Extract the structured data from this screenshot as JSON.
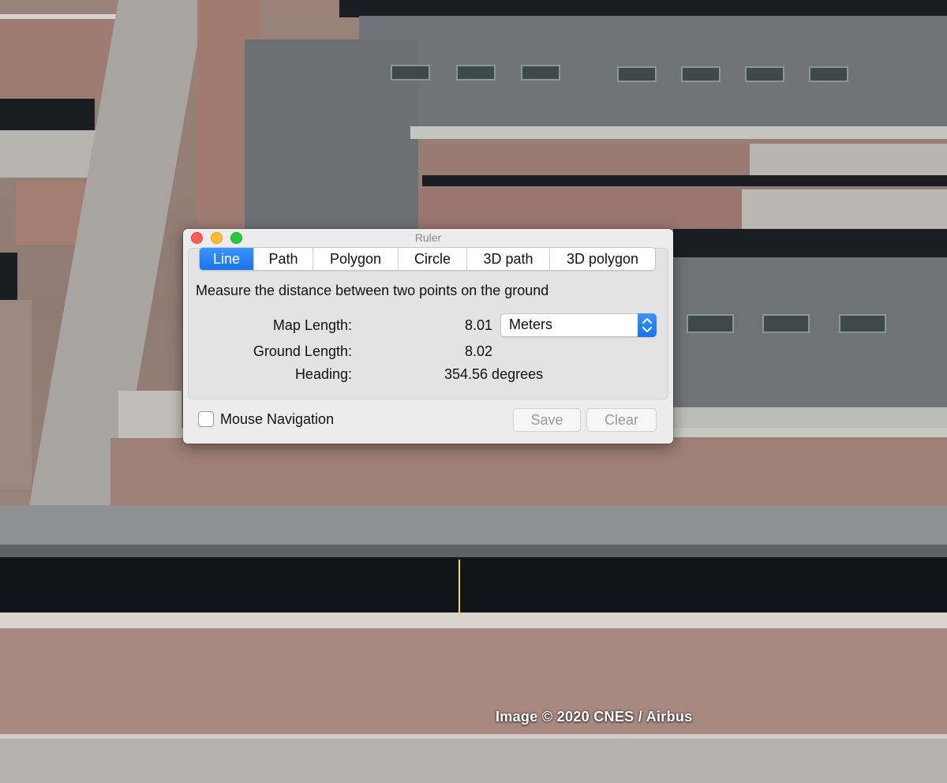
{
  "window": {
    "title": "Ruler"
  },
  "tabs": [
    {
      "label": "Line",
      "active": true
    },
    {
      "label": "Path",
      "active": false
    },
    {
      "label": "Polygon",
      "active": false
    },
    {
      "label": "Circle",
      "active": false
    },
    {
      "label": "3D path",
      "active": false
    },
    {
      "label": "3D polygon",
      "active": false
    }
  ],
  "description": "Measure the distance between two points on the ground",
  "measurements": {
    "map_length_label": "Map Length:",
    "map_length_value": "8.01",
    "unit_selected": "Meters",
    "ground_length_label": "Ground Length:",
    "ground_length_value": "8.02",
    "heading_label": "Heading:",
    "heading_value": "354.56 degrees"
  },
  "footer": {
    "mouse_navigation_label": "Mouse Navigation",
    "mouse_navigation_checked": false,
    "save_label": "Save",
    "clear_label": "Clear"
  },
  "map": {
    "copyright": "Image © 2020 CNES / Airbus",
    "measure_line_color": "#f2e411"
  },
  "colors": {
    "accent": "#1a73ea",
    "close": "#fe5f57",
    "minimize": "#febc2e",
    "maximize": "#28c840"
  }
}
